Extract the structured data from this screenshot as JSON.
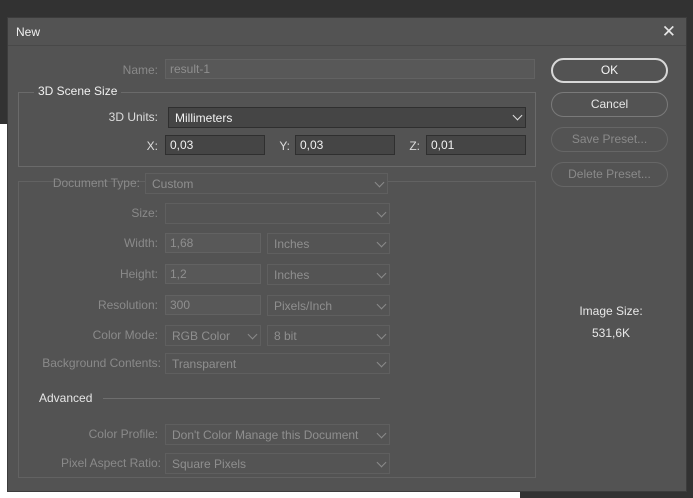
{
  "title": "New",
  "name": {
    "label": "Name:",
    "value": "result-1"
  },
  "scene": {
    "title": "3D Scene Size",
    "units_label": "3D Units:",
    "units_value": "Millimeters",
    "x_label": "X:",
    "x_value": "0,03",
    "y_label": "Y:",
    "y_value": "0,03",
    "z_label": "Z:",
    "z_value": "0,01"
  },
  "doc": {
    "type_label": "Document Type:",
    "type_value": "Custom",
    "size_label": "Size:",
    "size_value": "",
    "width_label": "Width:",
    "width_value": "1,68",
    "width_unit": "Inches",
    "height_label": "Height:",
    "height_value": "1,2",
    "height_unit": "Inches",
    "res_label": "Resolution:",
    "res_value": "300",
    "res_unit": "Pixels/Inch",
    "mode_label": "Color Mode:",
    "mode_value": "RGB Color",
    "depth_value": "8 bit",
    "bg_label": "Background Contents:",
    "bg_value": "Transparent"
  },
  "advanced": {
    "title": "Advanced",
    "profile_label": "Color Profile:",
    "profile_value": "Don't Color Manage this Document",
    "ratio_label": "Pixel Aspect Ratio:",
    "ratio_value": "Square Pixels"
  },
  "buttons": {
    "ok": "OK",
    "cancel": "Cancel",
    "save_preset": "Save Preset...",
    "delete_preset": "Delete Preset..."
  },
  "image_size": {
    "label": "Image Size:",
    "value": "531,6K"
  }
}
